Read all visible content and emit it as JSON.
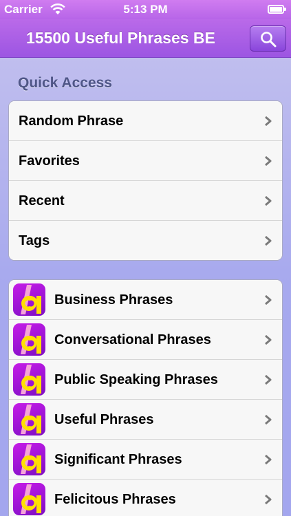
{
  "status_bar": {
    "carrier": "Carrier",
    "time": "5:13 PM"
  },
  "nav": {
    "title": "15500 Useful Phrases BE"
  },
  "quick_access": {
    "header": "Quick Access",
    "items": [
      {
        "label": "Random Phrase"
      },
      {
        "label": "Favorites"
      },
      {
        "label": "Recent"
      },
      {
        "label": "Tags"
      }
    ]
  },
  "categories": {
    "items": [
      {
        "label": "Business Phrases"
      },
      {
        "label": "Conversational Phrases"
      },
      {
        "label": "Public Speaking Phrases"
      },
      {
        "label": "Useful Phrases"
      },
      {
        "label": "Significant Phrases"
      },
      {
        "label": "Felicitous Phrases"
      }
    ]
  },
  "colors": {
    "nav_top": "#ba6ae9",
    "nav_bottom": "#9c55e2",
    "background": "#a7a9ee",
    "icon_magenta": "#c51ce6",
    "icon_yellow": "#ffe000",
    "section_header": "#4f5687"
  },
  "icons": {
    "search": "search-icon",
    "chevron": "chevron-right-icon",
    "app": "app-icon-letter-a",
    "wifi": "wifi-icon",
    "battery": "battery-icon"
  }
}
